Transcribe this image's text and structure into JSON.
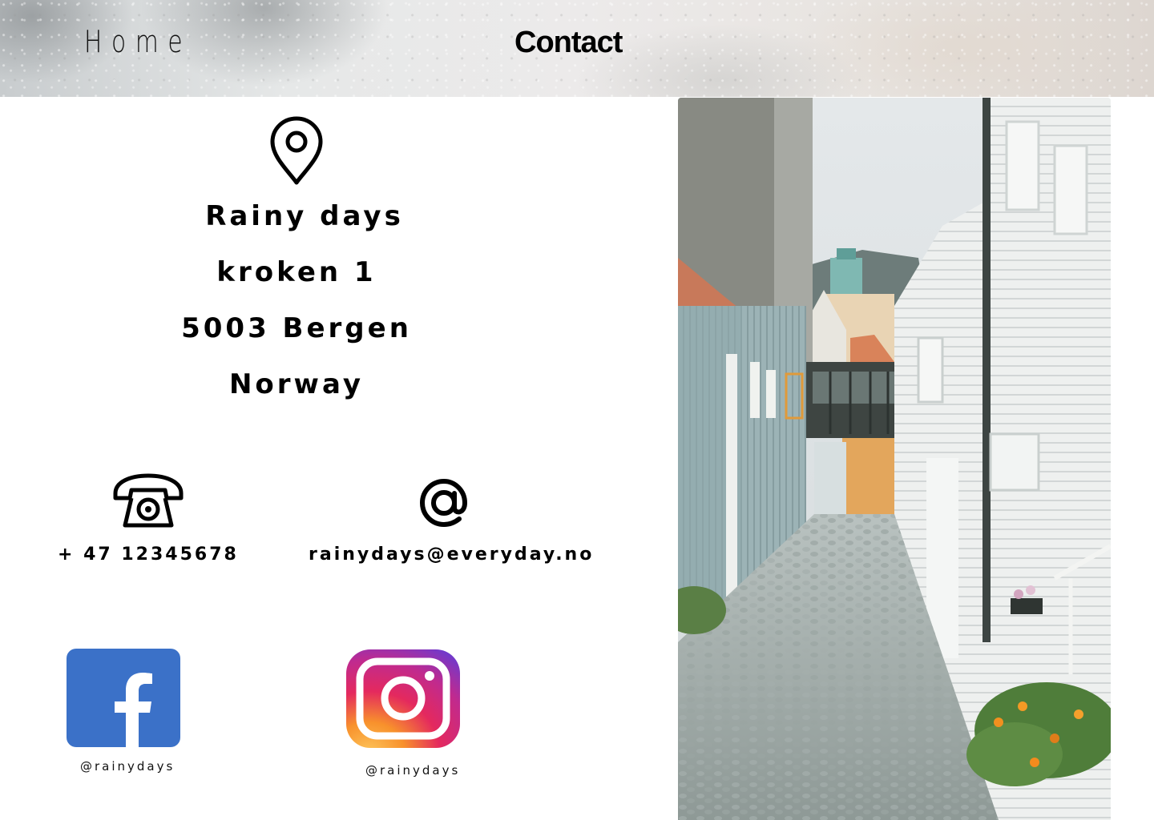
{
  "nav": {
    "home_label": "Home",
    "contact_label": "Contact"
  },
  "address": {
    "lines": [
      "Rainy days",
      "kroken 1",
      "5003 Bergen",
      "Norway"
    ]
  },
  "contact": {
    "phone": "+ 47 12345678",
    "email": "rainydays@everyday.no"
  },
  "social": {
    "facebook_handle": "@rainydays",
    "instagram_handle": "@rainydays"
  },
  "icons": {
    "location": "map-pin-icon",
    "phone": "telephone-icon",
    "email": "at-sign-icon",
    "facebook": "facebook-logo",
    "instagram": "instagram-logo"
  },
  "colors": {
    "facebook_blue": "#3b71c8",
    "text": "#000000",
    "background": "#ffffff"
  }
}
